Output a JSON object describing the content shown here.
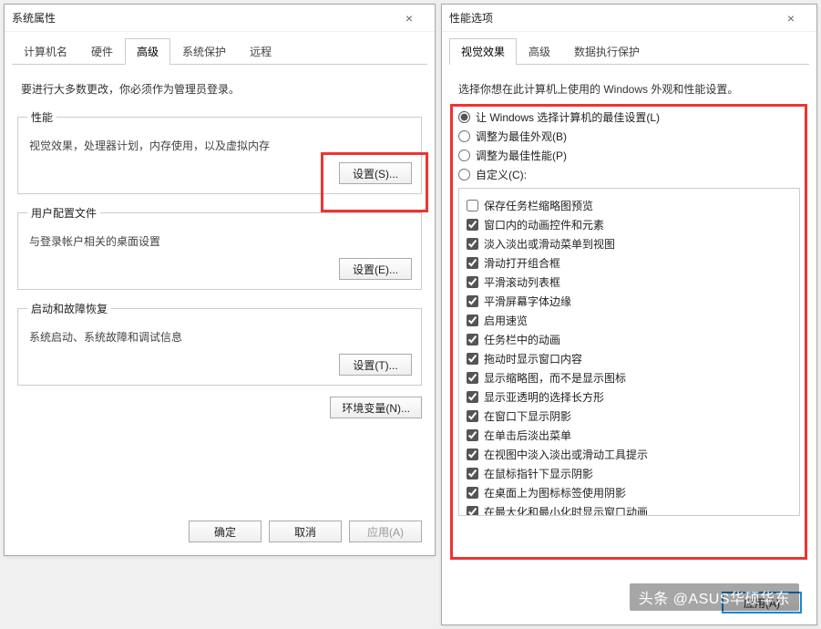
{
  "sysprops": {
    "title": "系统属性",
    "tabs": [
      "计算机名",
      "硬件",
      "高级",
      "系统保护",
      "远程"
    ],
    "active_tab": 2,
    "intro": "要进行大多数更改，你必须作为管理员登录。",
    "groups": {
      "perf": {
        "legend": "性能",
        "desc": "视觉效果，处理器计划，内存使用，以及虚拟内存",
        "button": "设置(S)..."
      },
      "profile": {
        "legend": "用户配置文件",
        "desc": "与登录帐户相关的桌面设置",
        "button": "设置(E)..."
      },
      "startup": {
        "legend": "启动和故障恢复",
        "desc": "系统启动、系统故障和调试信息",
        "button": "设置(T)..."
      }
    },
    "env_button": "环境变量(N)...",
    "footer": {
      "ok": "确定",
      "cancel": "取消",
      "apply": "应用(A)"
    }
  },
  "perfopts": {
    "title": "性能选项",
    "tabs": [
      "视觉效果",
      "高级",
      "数据执行保护"
    ],
    "active_tab": 0,
    "intro": "选择你想在此计算机上使用的 Windows 外观和性能设置。",
    "radios": [
      "让 Windows 选择计算机的最佳设置(L)",
      "调整为最佳外观(B)",
      "调整为最佳性能(P)",
      "自定义(C):"
    ],
    "radio_selected": 0,
    "checks": [
      {
        "label": "保存任务栏缩略图预览",
        "checked": false
      },
      {
        "label": "窗口内的动画控件和元素",
        "checked": true
      },
      {
        "label": "淡入淡出或滑动菜单到视图",
        "checked": true
      },
      {
        "label": "滑动打开组合框",
        "checked": true
      },
      {
        "label": "平滑滚动列表框",
        "checked": true
      },
      {
        "label": "平滑屏幕字体边缘",
        "checked": true
      },
      {
        "label": "启用速览",
        "checked": true
      },
      {
        "label": "任务栏中的动画",
        "checked": true
      },
      {
        "label": "拖动时显示窗口内容",
        "checked": true
      },
      {
        "label": "显示缩略图，而不是显示图标",
        "checked": true
      },
      {
        "label": "显示亚透明的选择长方形",
        "checked": true
      },
      {
        "label": "在窗口下显示阴影",
        "checked": true
      },
      {
        "label": "在单击后淡出菜单",
        "checked": true
      },
      {
        "label": "在视图中淡入淡出或滑动工具提示",
        "checked": true
      },
      {
        "label": "在鼠标指针下显示阴影",
        "checked": true
      },
      {
        "label": "在桌面上为图标标签使用阴影",
        "checked": true
      },
      {
        "label": "在最大化和最小化时显示窗口动画",
        "checked": true
      }
    ],
    "apply": "应用(A)"
  },
  "watermark": "头条 @ASUS华硕华东"
}
